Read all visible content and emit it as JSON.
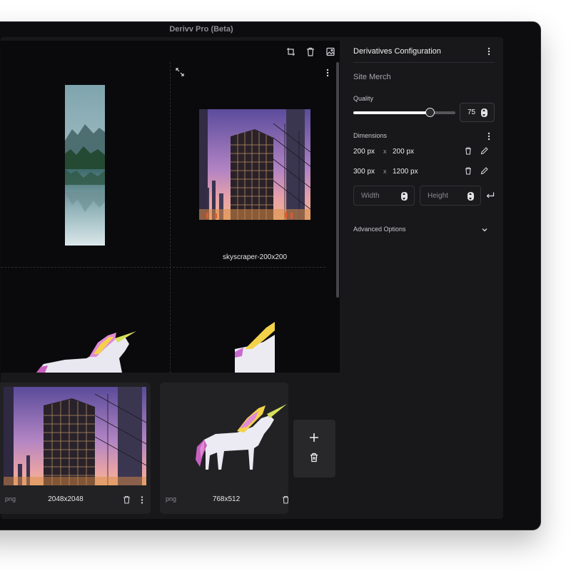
{
  "window": {
    "title": "Derivv Pro (Beta)"
  },
  "canvas": {
    "selected_caption": "skyscraper-200x200",
    "toolbar": {
      "icons": [
        "crop-icon",
        "trash-icon",
        "image-settings-icon"
      ]
    }
  },
  "filmstrip": {
    "items": [
      {
        "format": "png",
        "dimensions": "2048x2048",
        "image": "skyscraper"
      },
      {
        "format": "png",
        "dimensions": "768x512",
        "image": "unicorn"
      }
    ]
  },
  "panel": {
    "title": "Derivatives Configuration",
    "preset_name": "Site Merch",
    "quality": {
      "label": "Quality",
      "value": "75",
      "fraction": 0.75
    },
    "dimensions": {
      "label": "Dimensions",
      "rows": [
        {
          "width": "200 px",
          "height": "200 px"
        },
        {
          "width": "300 px",
          "height": "1200 px"
        }
      ],
      "times": "x",
      "width_placeholder": "Width",
      "height_placeholder": "Height"
    },
    "advanced_label": "Advanced Options"
  },
  "colors": {
    "background": "#18181b",
    "canvas": "#0a0a0c",
    "accent": "#f5f5f7"
  }
}
